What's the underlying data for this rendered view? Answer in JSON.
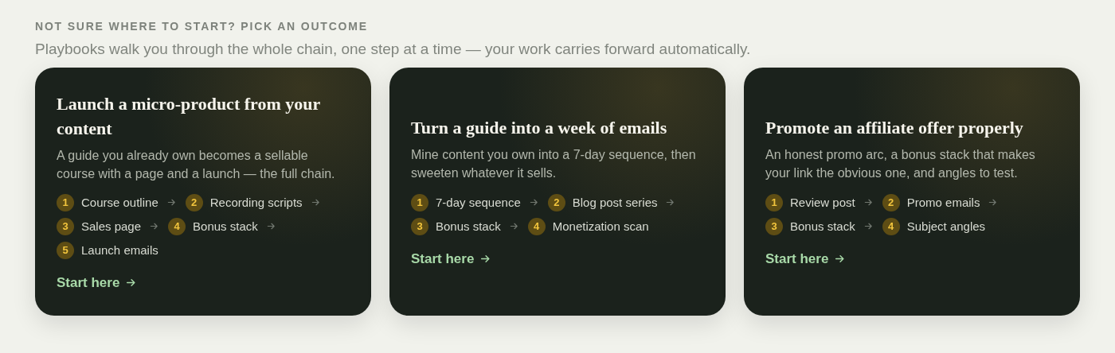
{
  "eyebrow": "NOT SURE WHERE TO START? PICK AN OUTCOME",
  "intro": "Playbooks walk you through the whole chain, one step at a time — your work carries forward automatically.",
  "cards": [
    {
      "title": "Launch a micro-product from your content",
      "description": "A guide you already own becomes a sellable course with a page and a launch — the full chain.",
      "step_rows": [
        [
          {
            "number": "1",
            "label": "Course outline"
          },
          {
            "number": "2",
            "label": "Recording scripts"
          }
        ],
        [
          {
            "number": "3",
            "label": "Sales page"
          },
          {
            "number": "4",
            "label": "Bonus stack"
          }
        ],
        [
          {
            "number": "5",
            "label": "Launch emails"
          }
        ]
      ],
      "link": "Start here"
    },
    {
      "title": "Turn a guide into a week of emails",
      "description": "Mine content you own into a 7-day sequence, then sweeten whatever it sells.",
      "step_rows": [
        [
          {
            "number": "1",
            "label": "7-day sequence"
          },
          {
            "number": "2",
            "label": "Blog post series"
          }
        ],
        [
          {
            "number": "3",
            "label": "Bonus stack"
          },
          {
            "number": "4",
            "label": "Monetization scan"
          }
        ]
      ],
      "link": "Start here"
    },
    {
      "title": "Promote an affiliate offer properly",
      "description": "An honest promo arc, a bonus stack that makes your link the obvious one, and angles to test.",
      "step_rows": [
        [
          {
            "number": "1",
            "label": "Review post"
          },
          {
            "number": "2",
            "label": "Promo emails"
          }
        ],
        [
          {
            "number": "3",
            "label": "Bonus stack"
          },
          {
            "number": "4",
            "label": "Subject angles"
          }
        ]
      ],
      "link": "Start here"
    }
  ]
}
